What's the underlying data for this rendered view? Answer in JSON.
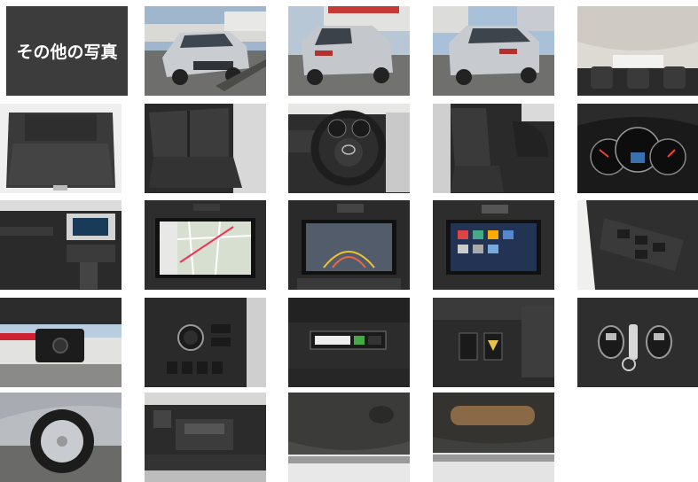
{
  "gallery": {
    "label": "その他の写真",
    "photos": [
      {
        "name": "label-tile"
      },
      {
        "name": "exterior-front-left-photo"
      },
      {
        "name": "exterior-rear-left-photo"
      },
      {
        "name": "exterior-rear-right-photo"
      },
      {
        "name": "interior-headliner-photo"
      },
      {
        "name": "cargo-area-photo"
      },
      {
        "name": "rear-seats-photo"
      },
      {
        "name": "steering-wheel-photo"
      },
      {
        "name": "front-seats-photo"
      },
      {
        "name": "gauge-cluster-photo"
      },
      {
        "name": "dashboard-side-photo"
      },
      {
        "name": "navigation-map-photo"
      },
      {
        "name": "rear-camera-screen-photo"
      },
      {
        "name": "audio-menu-screen-photo"
      },
      {
        "name": "window-switches-photo"
      },
      {
        "name": "dashcam-photo"
      },
      {
        "name": "push-start-button-photo"
      },
      {
        "name": "etc-unit-photo"
      },
      {
        "name": "switch-panel-photo"
      },
      {
        "name": "smart-keys-photo"
      },
      {
        "name": "wheel-tire-photo"
      },
      {
        "name": "engine-bay-photo"
      },
      {
        "name": "underbody-front-photo"
      },
      {
        "name": "underbody-rear-exhaust-photo"
      }
    ]
  },
  "colors": {
    "label_bg": "#3c3c3c",
    "label_text": "#ffffff",
    "page_bg": "#ffffff"
  }
}
